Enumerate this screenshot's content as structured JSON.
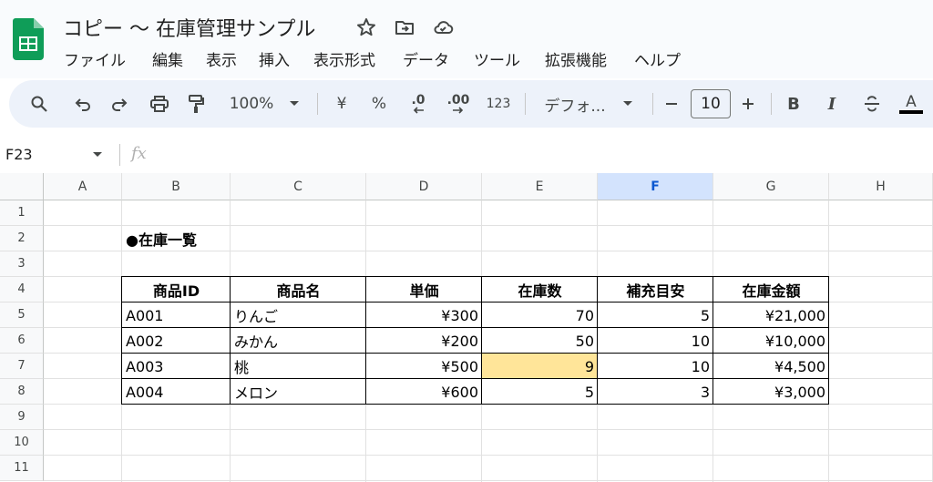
{
  "window": {
    "title": "コピー 〜 在庫管理サンプル"
  },
  "icons": {
    "app": "sheets-logo-icon",
    "star": "star-icon",
    "move": "move-to-folder-icon",
    "cloud": "cloud-saved-icon"
  },
  "menu": [
    "ファイル",
    "編集",
    "表示",
    "挿入",
    "表示形式",
    "データ",
    "ツール",
    "拡張機能",
    "ヘルプ"
  ],
  "toolbar": {
    "zoom": "100%",
    "currency": "¥",
    "percent": "%",
    "decrease_decimal": ".0",
    "increase_decimal": ".00",
    "number_format": "123",
    "font": "デフォ...",
    "font_size": "10",
    "bold": "B",
    "italic": "I",
    "text_color": "A"
  },
  "formula_bar": {
    "name_box": "F23",
    "fx": "fx",
    "value": ""
  },
  "grid": {
    "columns": [
      "A",
      "B",
      "C",
      "D",
      "E",
      "F",
      "G",
      "H"
    ],
    "selected_column": "F",
    "rows": [
      "1",
      "2",
      "3",
      "4",
      "5",
      "6",
      "7",
      "8",
      "9",
      "10",
      "11"
    ],
    "section_title": "●在庫一覧",
    "table": {
      "headers": [
        "商品ID",
        "商品名",
        "単価",
        "在庫数",
        "補充目安",
        "在庫金額"
      ],
      "rows": [
        [
          "A001",
          "りんご",
          "¥300",
          "70",
          "5",
          "¥21,000"
        ],
        [
          "A002",
          "みかん",
          "¥200",
          "50",
          "10",
          "¥10,000"
        ],
        [
          "A003",
          "桃",
          "¥500",
          "9",
          "10",
          "¥4,500"
        ],
        [
          "A004",
          "メロン",
          "¥600",
          "5",
          "3",
          "¥3,000"
        ]
      ],
      "highlight_color": "#ffe599"
    }
  }
}
